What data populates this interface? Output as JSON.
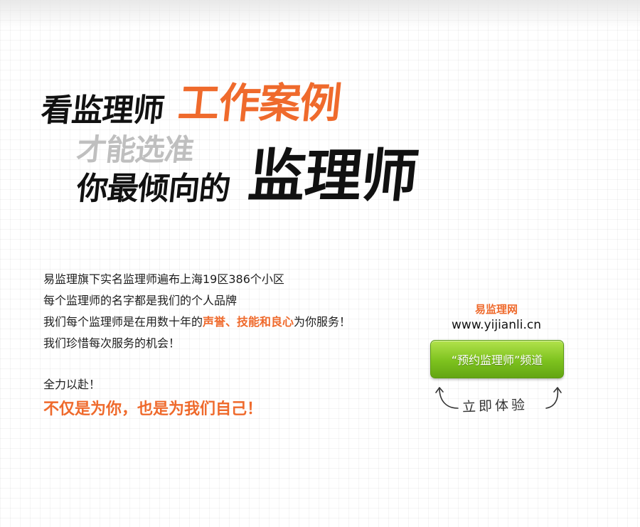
{
  "headline": {
    "line1_dark": "看监理师",
    "line1_accent": "工作案例",
    "line2": "才能选准",
    "line3_dark": "你最倾向的",
    "line3_big": "监理师"
  },
  "copy": {
    "lines": [
      "易监理旗下实名监理师遍布上海19区386个小区",
      "每个监理师的名字都是我们的个人品牌"
    ],
    "line3_pre": "我们每个监理师是在用数十年的",
    "line3_emph": "声誉、技能和良心",
    "line3_post": "为你服务！",
    "line4": "我们珍惜每次服务的机会！",
    "slogan_small": "全力以赴！",
    "slogan_big": "不仅是为你，也是为我们自己！"
  },
  "side": {
    "brand": "易监理网",
    "url": "www.yijianli.cn",
    "cta_label": "“预约监理师”频道",
    "handwritten": "立即体验"
  },
  "colors": {
    "accent": "#ef6a2c",
    "button_green": "#7dc21e",
    "text_dark": "#111111",
    "headline_gray": "#bfbfbf"
  },
  "icons": {
    "left_arrow": "curved-arrow-up-left-icon",
    "right_arrow": "curved-arrow-up-right-icon"
  }
}
